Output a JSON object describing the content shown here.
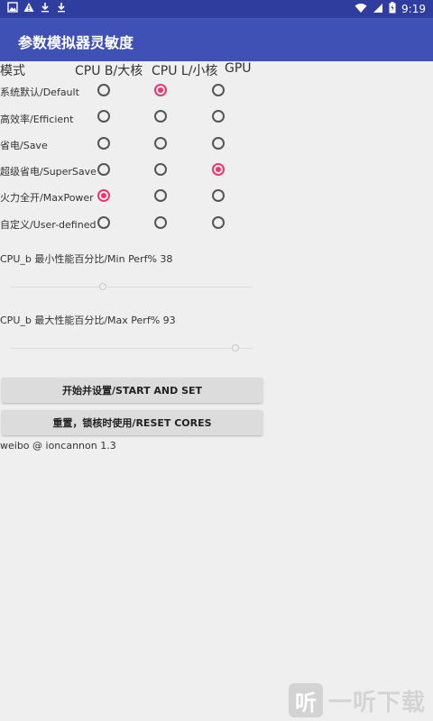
{
  "status_bar": {
    "time": "9:19",
    "left_icons": [
      "image-icon",
      "warning-icon",
      "download-icon",
      "download-icon"
    ],
    "right_icons": [
      "wifi-icon",
      "signal-icon",
      "battery-icon"
    ]
  },
  "app_bar": {
    "title": "参数模拟器灵敏度"
  },
  "table": {
    "headers": {
      "mode": "模式",
      "cpu_big": "CPU B/大核",
      "cpu_little": "CPU L/小核",
      "gpu": "GPU"
    },
    "rows": [
      {
        "label": "系统默认/Default",
        "selected": "cpu_little"
      },
      {
        "label": "高效率/Efficient",
        "selected": ""
      },
      {
        "label": "省电/Save",
        "selected": ""
      },
      {
        "label": "超级省电/SuperSave",
        "selected": "gpu"
      },
      {
        "label": "火力全开/MaxPower",
        "selected": "cpu_big"
      },
      {
        "label": "自定义/User-defined",
        "selected": ""
      }
    ]
  },
  "sliders": {
    "min_perf": {
      "label": "CPU_b 最小性能百分比/Min Perf% 38",
      "value": 38
    },
    "max_perf": {
      "label": "CPU_b 最大性能百分比/Max Perf% 93",
      "value": 93
    }
  },
  "buttons": {
    "start": "开始并设置/START AND SET",
    "reset": "重置，锁核时使用/RESET CORES"
  },
  "credit": "weibo @ ioncannon 1.3",
  "watermark": {
    "text": "一听下载",
    "logo_char": "听"
  },
  "colors": {
    "accent": "#e9386f",
    "primary": "#3f51b5",
    "primary_dark": "#2f3d9e"
  }
}
